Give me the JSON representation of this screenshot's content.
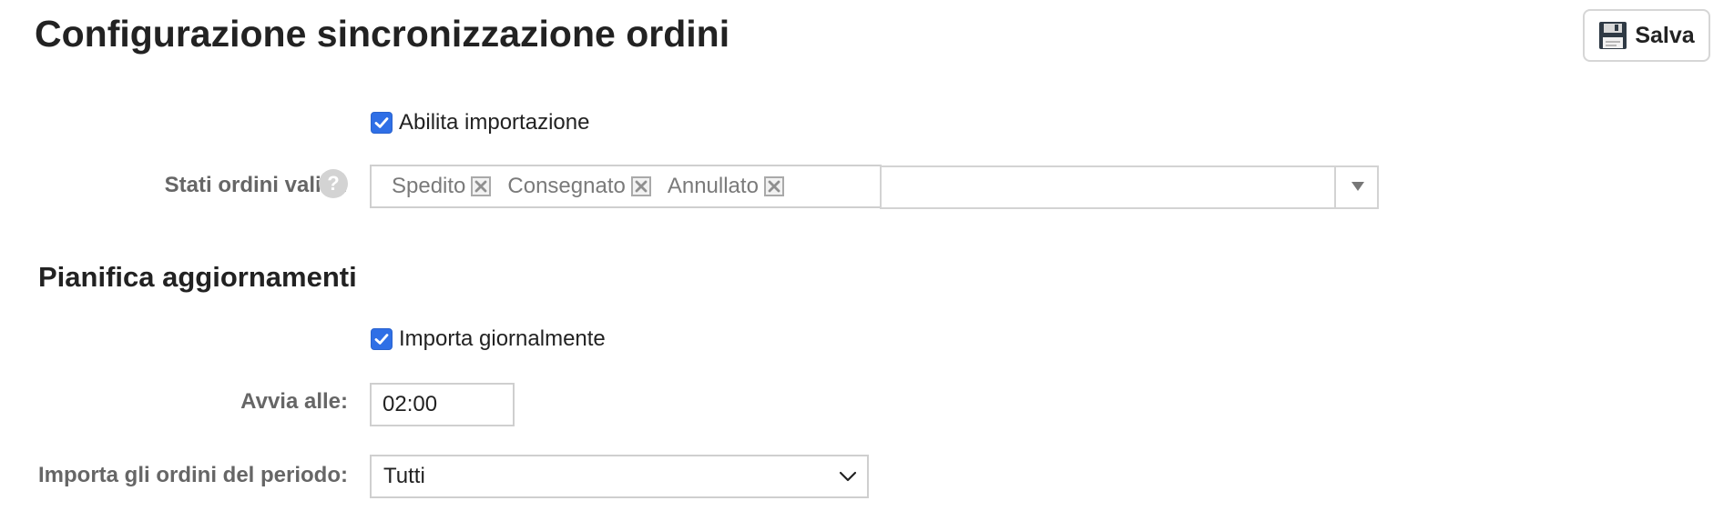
{
  "header": {
    "title": "Configurazione sincronizzazione ordini",
    "save_label": "Salva"
  },
  "import_section": {
    "enable_import": {
      "label": "Abilita importazione",
      "checked": true
    },
    "valid_states": {
      "label": "Stati ordini validi:",
      "help_icon": "help-icon",
      "tags": [
        {
          "label": "Spedito"
        },
        {
          "label": "Consegnato"
        },
        {
          "label": "Annullato"
        }
      ],
      "dropdown_value": ""
    }
  },
  "schedule_section": {
    "title": "Pianifica aggiornamenti",
    "daily_import": {
      "label": "Importa giornalmente",
      "checked": true
    },
    "start_at": {
      "label": "Avvia alle:",
      "value": "02:00"
    },
    "period": {
      "label": "Importa gli ordini del periodo:",
      "value": "Tutti"
    }
  },
  "colors": {
    "checkbox_blue": "#2f6fe6",
    "label_gray": "#666666",
    "tag_text_gray": "#7a7a7a",
    "border_gray": "#cfcfcf"
  },
  "icons": {
    "save": "floppy-disk-icon",
    "checkbox": "checkmark-icon",
    "tag_remove": "close-icon",
    "dropdown": "caret-down-icon",
    "select": "chevron-down-icon"
  }
}
